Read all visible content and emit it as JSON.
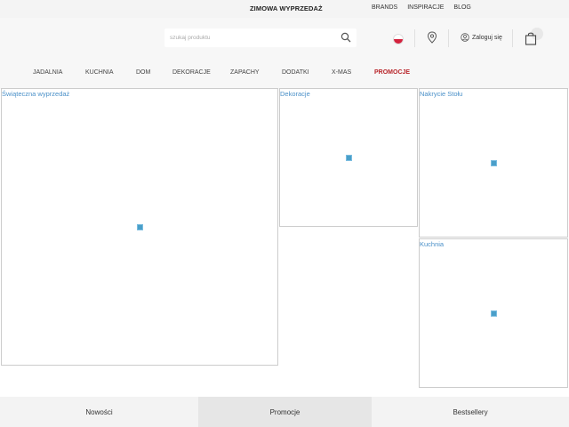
{
  "topbar": {
    "promo": "ZIMOWA WYPRZEDAŻ",
    "links": [
      "BRANDS",
      "INSPIRACJE",
      "BLOG"
    ]
  },
  "header": {
    "search_placeholder": "szukaj produktu",
    "login_label": "Zaloguj się",
    "flag": "pl-flag-icon"
  },
  "nav": {
    "items": [
      "JADALNIA",
      "KUCHNIA",
      "DOM",
      "DEKORACJE",
      "ZAPACHY",
      "DODATKI",
      "X-MAS",
      "PROMOCJE"
    ],
    "promo_color": "#b8262b"
  },
  "tiles": [
    {
      "label": "Świąteczna wyprzedaż"
    },
    {
      "label": "Dekoracje"
    },
    {
      "label": "Nakrycie Stołu"
    },
    {
      "label": "Kuchnia"
    }
  ],
  "tabs": [
    "Nowości",
    "Promocje",
    "Bestsellery"
  ],
  "accent": "#4a90c8"
}
